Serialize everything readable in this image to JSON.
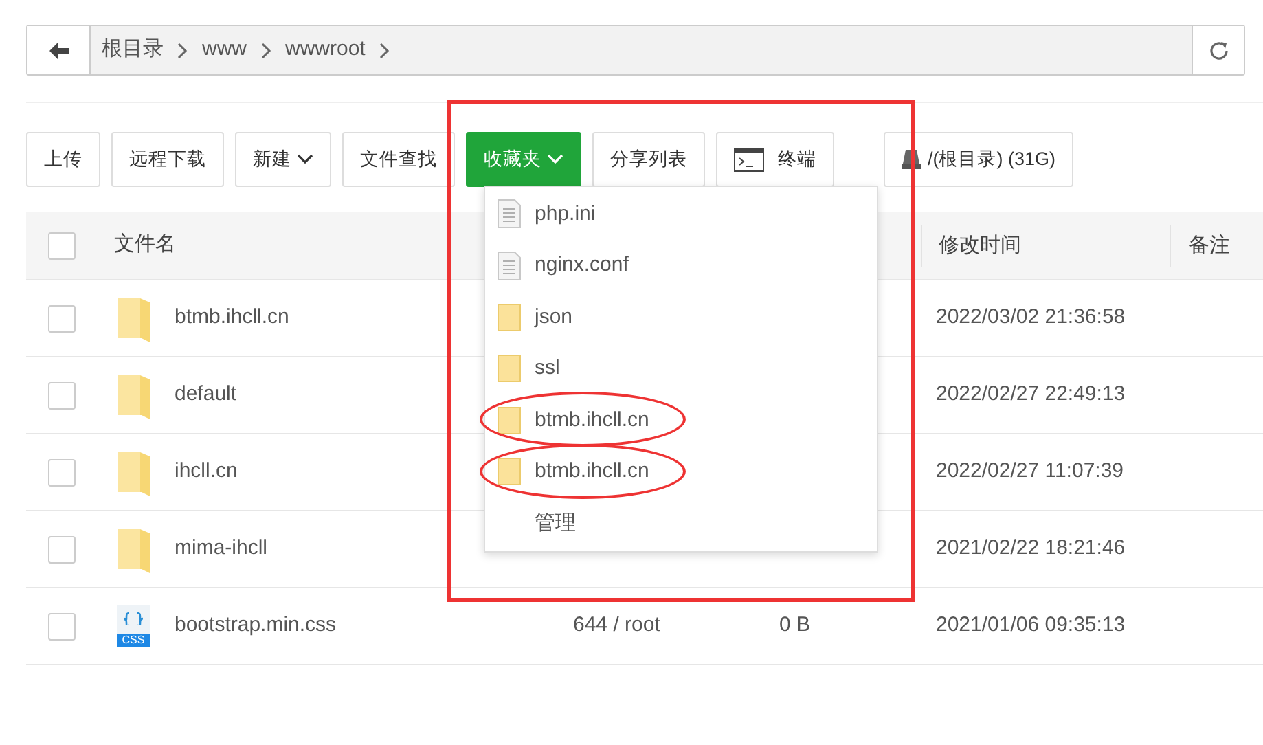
{
  "breadcrumb": [
    "根目录",
    "www",
    "wwwroot"
  ],
  "toolbar": [
    {
      "label": "上传",
      "kind": "plain"
    },
    {
      "label": "远程下载",
      "kind": "plain"
    },
    {
      "label": "新建",
      "kind": "caret"
    },
    {
      "label": "文件查找",
      "kind": "plain"
    },
    {
      "label": "收藏夹",
      "kind": "primary"
    },
    {
      "label": "分享列表",
      "kind": "plain"
    },
    {
      "label": "终端",
      "kind": "terminal"
    },
    {
      "label": "/(根目录) (31G)",
      "kind": "disk"
    }
  ],
  "table": {
    "columns": [
      "文件名",
      "修改时间",
      "备注"
    ],
    "all_checked": false,
    "rows": [
      {
        "name": "btmb.ihcll.cn",
        "kind": "folder",
        "checked": false,
        "modified": "2022/03/02 21:36:58"
      },
      {
        "name": "default",
        "kind": "folder",
        "checked": false,
        "modified": "2022/02/27 22:49:13"
      },
      {
        "name": "ihcll.cn",
        "kind": "folder",
        "checked": false,
        "modified": "2022/02/27 11:07:39"
      },
      {
        "name": "mima-ihcll",
        "kind": "folder",
        "checked": false,
        "modified": "2021/02/22 18:21:46"
      },
      {
        "name": "bootstrap.min.css",
        "kind": "css",
        "checked": false,
        "permission": "644 / root",
        "size": "0 B",
        "modified": "2021/01/06 09:35:13",
        "badge": "CSS"
      }
    ]
  },
  "favorites_menu": [
    {
      "label": "php.ini",
      "kind": "file",
      "circled": false
    },
    {
      "label": "nginx.conf",
      "kind": "file",
      "circled": false
    },
    {
      "label": "json",
      "kind": "folder",
      "circled": false
    },
    {
      "label": "ssl",
      "kind": "folder",
      "circled": false
    },
    {
      "label": "btmb.ihcll.cn",
      "kind": "folder",
      "circled": true
    },
    {
      "label": "btmb.ihcll.cn",
      "kind": "folder",
      "circled": true
    },
    {
      "label": "管理",
      "kind": "plain",
      "circled": false
    }
  ]
}
